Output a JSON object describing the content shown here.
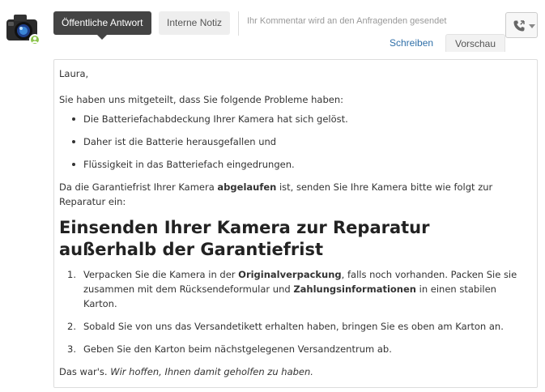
{
  "header": {
    "tab_public": "Öffentliche Antwort",
    "tab_internal": "Interne Notiz",
    "hint": "Ihr Kommentar wird an den Anfragenden gesendet",
    "mode_write": "Schreiben",
    "mode_preview": "Vorschau"
  },
  "icons": {
    "avatar": "camera-avatar",
    "badge": "user-badge-icon",
    "phone": "phone-icon",
    "chevron": "chevron-down-icon"
  },
  "colors": {
    "tab_active_bg": "#444444",
    "link": "#2f6fa8",
    "badge": "#8bc34a"
  },
  "preview": {
    "greeting": "Laura,",
    "intro": "Sie haben uns mitgeteilt, dass Sie folgende Probleme haben:",
    "bullets": [
      "Die Batteriefachabdeckung Ihrer Kamera hat sich gelöst.",
      "Daher ist die Batterie herausgefallen und",
      "Flüssigkeit in das Batteriefach eingedrungen."
    ],
    "para_pre": "Da die Garantiefrist Ihrer Kamera ",
    "para_bold": "abgelaufen",
    "para_post": " ist, senden Sie Ihre Kamera bitte wie folgt zur Reparatur ein:",
    "heading": "Einsenden Ihrer Kamera zur Reparatur außerhalb der Garantiefrist",
    "steps": [
      {
        "num": "1.",
        "t1": "Verpacken Sie die Kamera in der ",
        "b1": "Originalverpackung",
        "t2": ", falls noch vorhanden. Packen Sie sie zusammen mit dem Rücksendeformular und ",
        "b2": "Zahlungsinformationen",
        "t3": " in einen stabilen Karton."
      },
      {
        "num": "2.",
        "text": "Sobald Sie von uns das Versandetikett erhalten haben, bringen Sie es oben am Karton an."
      },
      {
        "num": "3.",
        "text": "Geben Sie den Karton beim nächstgelegenen Versandzentrum ab."
      }
    ],
    "closing_plain": "Das war's. ",
    "closing_italic": "Wir hoffen, Ihnen damit geholfen zu haben."
  }
}
